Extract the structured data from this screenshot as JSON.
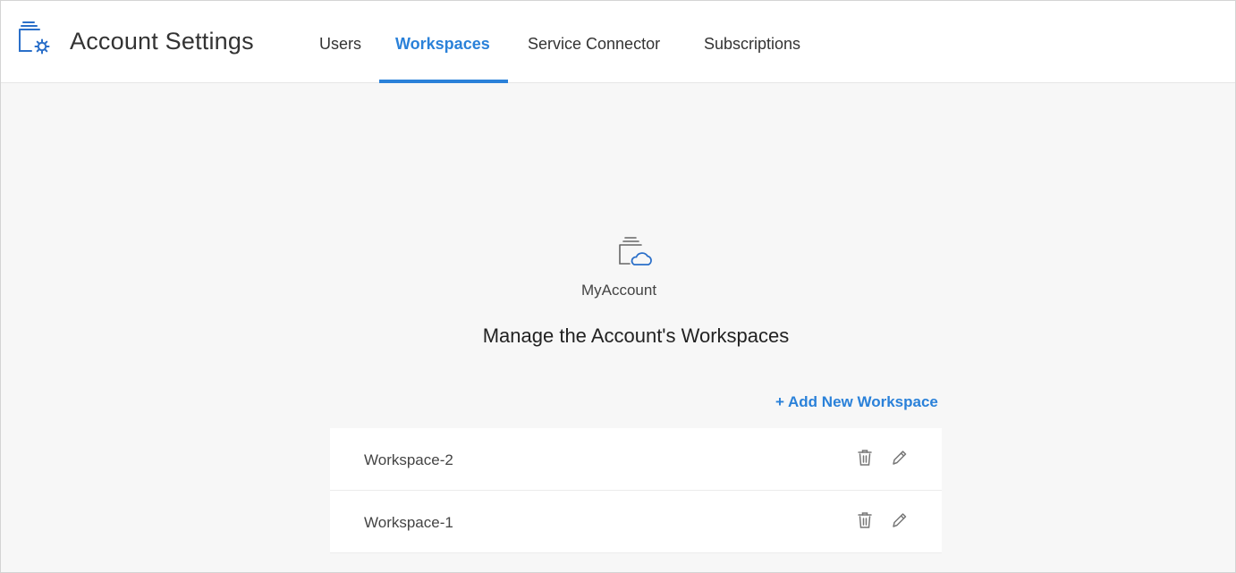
{
  "header": {
    "title": "Account Settings",
    "tabs": [
      {
        "label": "Users",
        "active": false
      },
      {
        "label": "Workspaces",
        "active": true
      },
      {
        "label": "Service Connector",
        "active": false
      },
      {
        "label": "Subscriptions",
        "active": false
      }
    ]
  },
  "main": {
    "account_name": "MyAccount",
    "section_title": "Manage the Account's Workspaces",
    "add_workspace_label": "+ Add New Workspace",
    "workspaces": [
      {
        "name": "Workspace-2"
      },
      {
        "name": "Workspace-1"
      }
    ]
  },
  "icons": {
    "brand": "account-settings-gear-icon",
    "center": "account-cloud-icon",
    "trash": "trash-icon",
    "edit": "pencil-icon"
  },
  "colors": {
    "accent": "#2a81d9",
    "icon_blue": "#2a6fc9",
    "background": "#f7f7f7"
  }
}
